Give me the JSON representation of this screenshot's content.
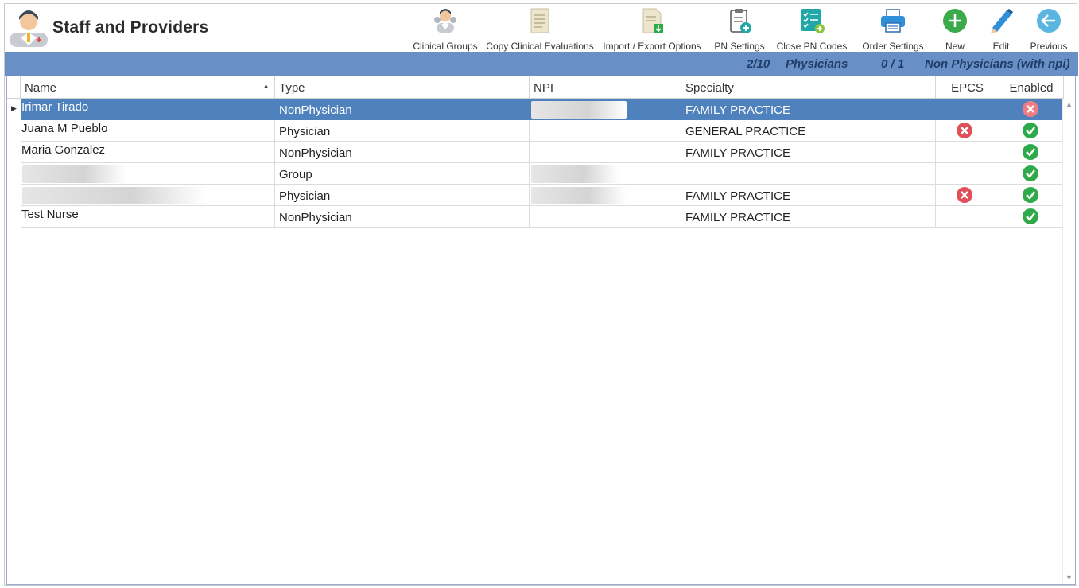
{
  "header": {
    "title": "Staff and Providers",
    "logo_icon": "staff-doctor-icon"
  },
  "toolbar": [
    {
      "label": "Clinical Groups",
      "icon": "clinical-groups-icon"
    },
    {
      "label": "Copy Clinical Evaluations",
      "icon": "copy-document-icon"
    },
    {
      "label": "Import / Export Options",
      "icon": "import-export-icon"
    },
    {
      "label": "PN Settings",
      "icon": "pn-settings-icon"
    },
    {
      "label": "Close PN Codes",
      "icon": "checklist-add-icon"
    },
    {
      "label": "Order Settings",
      "icon": "printer-icon"
    },
    {
      "label": "New",
      "icon": "plus-circle-icon"
    },
    {
      "label": "Edit",
      "icon": "pencil-icon"
    },
    {
      "label": "Previous",
      "icon": "back-arrow-icon"
    }
  ],
  "summary": {
    "physicians_count": "2/10",
    "physicians_label": "Physicians",
    "non_physicians_count": "0 / 1",
    "non_physicians_label": "Non Physicians (with npi)"
  },
  "grid": {
    "columns": [
      "Name",
      "Type",
      "NPI",
      "Specialty",
      "EPCS",
      "Enabled"
    ],
    "sort_column": "Name",
    "rows": [
      {
        "name": "Irimar Tirado",
        "type": "NonPhysician",
        "npi": "",
        "specialty": "FAMILY PRACTICE",
        "epcs": "",
        "enabled": "no",
        "selected": true
      },
      {
        "name": "Juana M Pueblo",
        "type": "Physician",
        "npi": "",
        "specialty": "GENERAL PRACTICE",
        "epcs": "no",
        "enabled": "yes"
      },
      {
        "name": "Maria Gonzalez",
        "type": "NonPhysician",
        "npi": "",
        "specialty": "FAMILY PRACTICE",
        "epcs": "",
        "enabled": "yes"
      },
      {
        "name": "",
        "type": "Group",
        "npi": "",
        "specialty": "",
        "epcs": "",
        "enabled": "yes"
      },
      {
        "name": "",
        "type": "Physician",
        "npi": "",
        "specialty": "FAMILY PRACTICE",
        "epcs": "no",
        "enabled": "yes"
      },
      {
        "name": "Test Nurse",
        "type": "NonPhysician",
        "npi": "",
        "specialty": "FAMILY PRACTICE",
        "epcs": "",
        "enabled": "yes"
      }
    ]
  },
  "colors": {
    "summary_bar": "#6890c6",
    "selected_row": "#4f81bd",
    "enabled_green": "#2eaa4a",
    "disabled_red": "#e0505a"
  }
}
